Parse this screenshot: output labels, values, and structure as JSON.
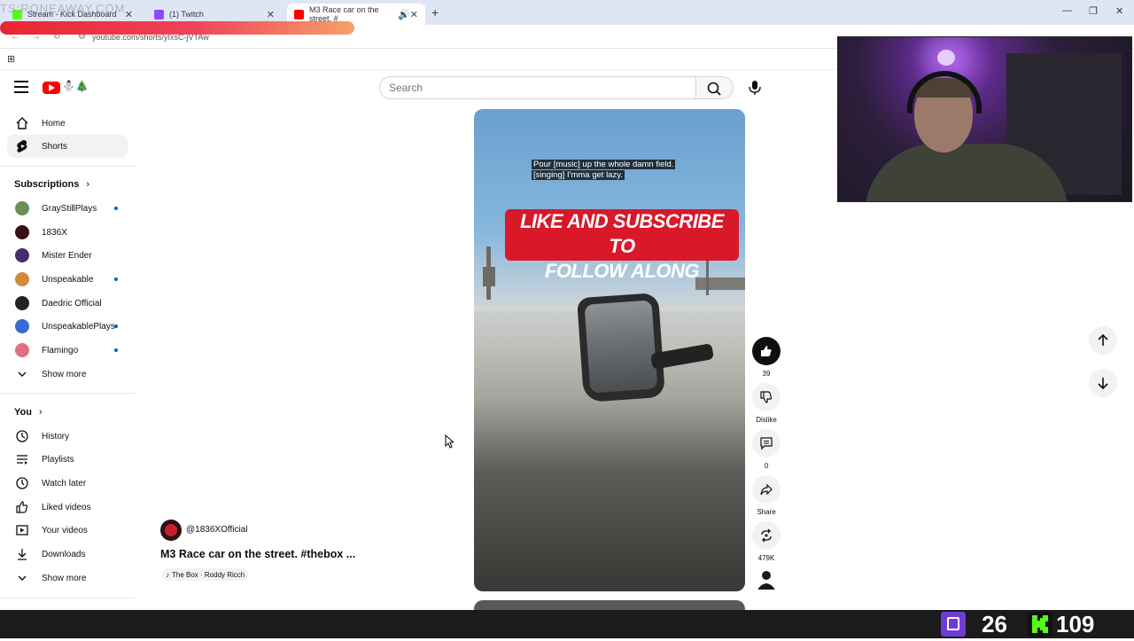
{
  "browser": {
    "tabs": [
      {
        "label": "Stream - Kick Dashboard",
        "color": "#53fc18"
      },
      {
        "label": "(1) Twitch",
        "color": "#9146ff"
      },
      {
        "label": "M3 Race car on the street. #",
        "color": "#ff0000",
        "active": true
      }
    ],
    "url": "youtube.com/shorts/yIxsC-jVTAw"
  },
  "overlay_text": "TS:RONEAWAY.COM",
  "header": {
    "search_placeholder": "Search"
  },
  "sidebar": {
    "main": [
      {
        "label": "Home",
        "icon": "home-icon"
      },
      {
        "label": "Shorts",
        "icon": "shorts-icon",
        "selected": true
      }
    ],
    "subscriptions_title": "Subscriptions",
    "subscriptions": [
      {
        "label": "GrayStillPlays",
        "new": true,
        "color": "#6a8f5a"
      },
      {
        "label": "1836X",
        "new": false,
        "color": "#3a1015"
      },
      {
        "label": "Mister Ender",
        "new": false,
        "color": "#4a2a6a"
      },
      {
        "label": "Unspeakable",
        "new": true,
        "color": "#d08a3a"
      },
      {
        "label": "Daedric Official",
        "new": false,
        "color": "#222222"
      },
      {
        "label": "UnspeakablePlays",
        "new": true,
        "color": "#3a6ad0"
      },
      {
        "label": "Flamingo",
        "new": true,
        "color": "#e07080"
      }
    ],
    "show_more": "Show more",
    "you_title": "You",
    "you": [
      {
        "label": "History",
        "icon": "history-icon"
      },
      {
        "label": "Playlists",
        "icon": "playlists-icon"
      },
      {
        "label": "Watch later",
        "icon": "clock-icon"
      },
      {
        "label": "Liked videos",
        "icon": "thumbs-up-icon"
      },
      {
        "label": "Your videos",
        "icon": "video-icon"
      },
      {
        "label": "Downloads",
        "icon": "download-icon"
      }
    ],
    "show_more_2": "Show more"
  },
  "video": {
    "caption_line1": "Pour [music] up the whole damn field.",
    "caption_line2": "[singing] I'mma get lazy.",
    "banner_line1": "LIKE AND SUBSCRIBE TO",
    "banner_line2": "FOLLOW ALONG"
  },
  "actions": {
    "likes": "39",
    "dislike": "Dislike",
    "comments": "0",
    "share": "Share",
    "remix": "479K"
  },
  "channel": {
    "handle": "@1836XOfficial",
    "title": "M3 Race car on the street. #thebox ...",
    "sound": "The Box · Roddy Ricch"
  },
  "stream": {
    "twitch_count": "26",
    "kick_count": "109"
  }
}
